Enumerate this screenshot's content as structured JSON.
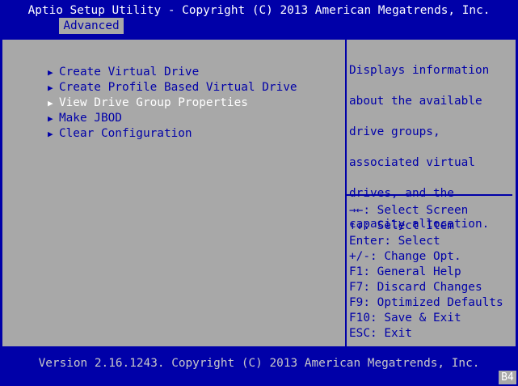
{
  "header": {
    "title": "Aptio Setup Utility - Copyright (C) 2013 American Megatrends, Inc.",
    "active_tab": "Advanced"
  },
  "menu": {
    "items": [
      {
        "label": "Create Virtual Drive",
        "selected": false
      },
      {
        "label": "Create Profile Based Virtual Drive",
        "selected": false
      },
      {
        "label": "View Drive Group Properties",
        "selected": true
      },
      {
        "label": "Make JBOD",
        "selected": false
      },
      {
        "label": "Clear Configuration",
        "selected": false
      }
    ]
  },
  "help": {
    "lines": [
      "Displays information",
      "about the available",
      "drive groups,",
      "associated virtual",
      "drives, and the",
      "capacity allocation."
    ]
  },
  "keys": [
    "→←: Select Screen",
    "↑↓: Select Item",
    "Enter: Select",
    "+/-: Change Opt.",
    "F1: General Help",
    "F7: Discard Changes",
    "F9: Optimized Defaults",
    "F10: Save & Exit",
    "ESC: Exit"
  ],
  "footer": {
    "version": "Version 2.16.1243. Copyright (C) 2013 American Megatrends, Inc.",
    "badge": "B4"
  },
  "colors": {
    "background": "#0000a8",
    "panel": "#a8a8a8",
    "text_dark": "#0000a8",
    "text_highlight": "#ffffff"
  },
  "icons": {
    "menu_item": "arrow-right-icon"
  }
}
